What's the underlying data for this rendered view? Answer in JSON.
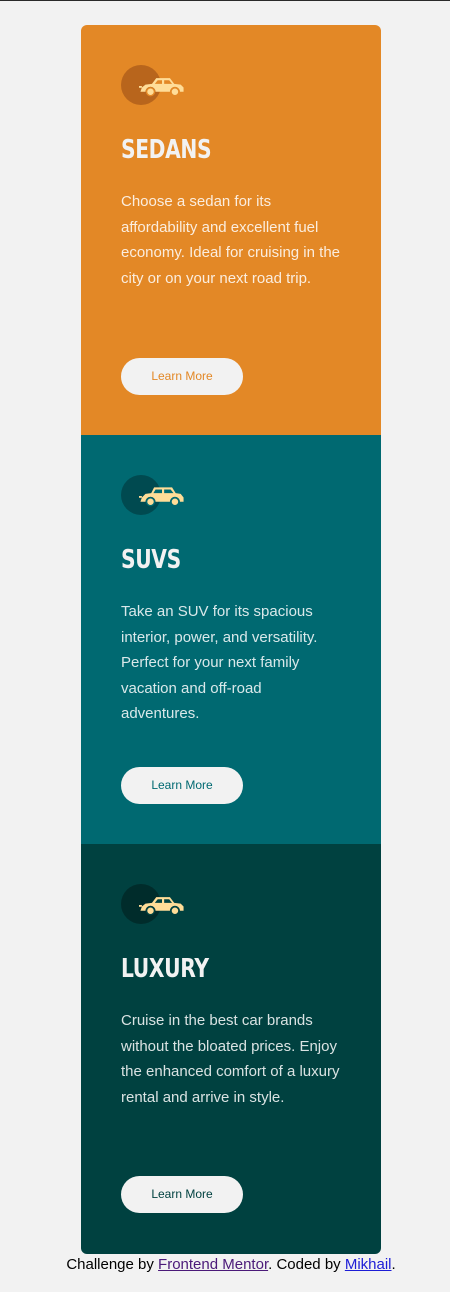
{
  "cards": [
    {
      "title": "SEDANS",
      "text": "Choose a sedan for its affordability and excellent fuel economy. Ideal for cruising in the city or on your next road trip.",
      "button": "Learn More",
      "icon": "sedan-car-icon",
      "bg_color": "#e38826",
      "accent_color": "#e38826",
      "icon_circle_color": "#b8651c"
    },
    {
      "title": "SUVS",
      "text": "Take an SUV for its spacious interior, power, and versatility. Perfect for your next family vacation and off-road adventures.",
      "button": "Learn More",
      "icon": "suv-car-icon",
      "bg_color": "#006971",
      "accent_color": "#006971",
      "icon_circle_color": "#004a50"
    },
    {
      "title": "LUXURY",
      "text": "Cruise in the best car brands without the bloated prices. Enjoy the enhanced comfort of a luxury rental and arrive in style.",
      "button": "Learn More",
      "icon": "luxury-car-icon",
      "bg_color": "#004140",
      "accent_color": "#004140",
      "icon_circle_color": "#002c2b"
    }
  ],
  "attribution": {
    "prefix": "Challenge by ",
    "link1": "Frontend Mentor",
    "middle": ". Coded by ",
    "link2": "Mikhail",
    "suffix": "."
  },
  "colors": {
    "page_bg": "#f2f2f2",
    "car_icon": "#ffdd98"
  }
}
